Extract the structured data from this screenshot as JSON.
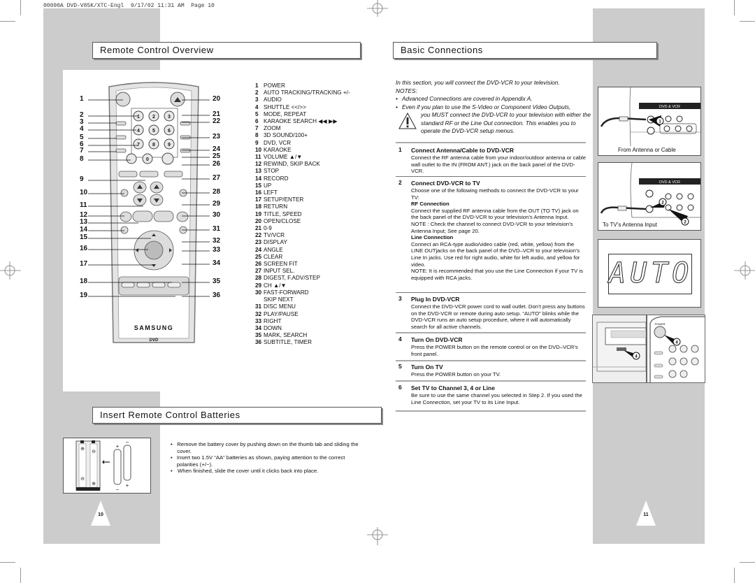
{
  "print_header": "00090A DVD-V85K/XTC-Engl  9/17/02 11:31 AM  Page 10",
  "left_page": {
    "section_title": "Remote Control Overview",
    "remote": {
      "brand": "SAMSUNG",
      "logo": "DVD",
      "callouts_left": [
        "1",
        "2",
        "3",
        "4",
        "5",
        "6",
        "7",
        "8",
        "9",
        "10",
        "11",
        "12",
        "13",
        "14",
        "15",
        "16",
        "17",
        "18",
        "19"
      ],
      "callouts_right": [
        "20",
        "21",
        "22",
        "23",
        "24",
        "25",
        "26",
        "27",
        "28",
        "29",
        "30",
        "31",
        "32",
        "33",
        "34",
        "35",
        "36"
      ]
    },
    "legend": [
      {
        "n": "1",
        "label": "POWER"
      },
      {
        "n": "2",
        "label": "AUTO TRACKING/TRACKING +/-"
      },
      {
        "n": "3",
        "label": "AUDIO"
      },
      {
        "n": "4",
        "label": "SHUTTLE <</>>"
      },
      {
        "n": "5",
        "label": "MODE, REPEAT"
      },
      {
        "n": "6",
        "label": "KARAOKE SEARCH ◀◀ ▶▶"
      },
      {
        "n": "7",
        "label": "ZOOM"
      },
      {
        "n": "8",
        "label": "3D SOUND/100+"
      },
      {
        "n": "9",
        "label": "DVD, VCR"
      },
      {
        "n": "10",
        "label": "KARAOKE"
      },
      {
        "n": "11",
        "label": "VOLUME ▲/▼"
      },
      {
        "n": "12",
        "label": "REWIND, SKIP BACK"
      },
      {
        "n": "13",
        "label": "STOP"
      },
      {
        "n": "14",
        "label": "RECORD"
      },
      {
        "n": "15",
        "label": "UP"
      },
      {
        "n": "16",
        "label": "LEFT"
      },
      {
        "n": "17",
        "label": "SETUP/ENTER"
      },
      {
        "n": "18",
        "label": "RETURN"
      },
      {
        "n": "19",
        "label": "TITLE, SPEED"
      },
      {
        "n": "20",
        "label": "OPEN/CLOSE"
      },
      {
        "n": "21",
        "label": "0-9"
      },
      {
        "n": "22",
        "label": "TV/VCR"
      },
      {
        "n": "23",
        "label": "DISPLAY"
      },
      {
        "n": "24",
        "label": "ANGLE"
      },
      {
        "n": "25",
        "label": "CLEAR"
      },
      {
        "n": "26",
        "label": "SCREEN FIT"
      },
      {
        "n": "27",
        "label": "INPUT SEL."
      },
      {
        "n": "28",
        "label": "DIGEST, F.ADV/STEP"
      },
      {
        "n": "29",
        "label": "CH ▲/▼"
      },
      {
        "n": "30",
        "label": "FAST-FORWARD"
      },
      {
        "n": "",
        "label": "SKIP NEXT"
      },
      {
        "n": "31",
        "label": "DISC MENU"
      },
      {
        "n": "32",
        "label": "PLAY/PAUSE"
      },
      {
        "n": "33",
        "label": "RIGHT"
      },
      {
        "n": "34",
        "label": "DOWN"
      },
      {
        "n": "35",
        "label": "MARK, SEARCH"
      },
      {
        "n": "36",
        "label": "SUBTITLE, TIMER"
      }
    ],
    "batteries": {
      "section_title": "Insert Remote Control Batteries",
      "bullets": [
        "Remove the battery cover by pushing down on the thumb tab and sliding the cover.",
        "Insert two 1.5V “AA” batteries as shown, paying attention to the correct polarities (+/−).",
        "When finished, slide the cover until it clicks back into place."
      ]
    },
    "page_number": "10"
  },
  "right_page": {
    "section_title": "Basic Connections",
    "intro": "In this section, you will connect the DVD-VCR to your television.",
    "notes_label": "NOTES:",
    "notes": [
      "Advanced Connections are covered in Appendix A.",
      "Even if you plan to use the S-Video or Component Video Outputs,"
    ],
    "warning": "you MUST connect the DVD-VCR to your television with either the standard RF or the Line Out connection. This enables you to operate the DVD-VCR setup menus.",
    "steps": [
      {
        "n": "1",
        "title": "Connect Antenna/Cable to DVD-VCR",
        "body": "Connect the RF antenna cable from your indoor/outdoor antenna or cable wall outlet to the IN (FROM ANT.) jack on the back panel of the DVD-VCR."
      },
      {
        "n": "2",
        "title": "Connect DVD-VCR to TV",
        "body": "Choose one of the following methods to connect the DVD-VCR to your TV:",
        "rf_label": "RF Connection",
        "rf_body": "Connect the supplied RF antenna cable from the OUT (TO TV) jack on the back panel of the DVD-VCR to your television’s Antenna Input.",
        "rf_note": "NOTE : Check the channel to connect DVD-VCR to your television’s Antenna Input; See page 20.",
        "line_label": "Line Connection",
        "line_body": "Connect an RCA-type audio/video cable (red, white, yellow) from the LINE OUTjacks on the back panel of the DVD–VCR to your television’s Line In jacks. Use red for right audio, white for left audio, and yellow for video.",
        "line_note": "NOTE: It is recommended that you use the Line Connection if your TV is equipped with RCA jacks."
      },
      {
        "n": "3",
        "title": "Plug In DVD-VCR",
        "body": "Connect the DVD-VCR power cord to wall outlet. Don’t press any buttons on the DVD-VCR or remote during auto setup. “AUTO” blinks while the DVD-VCR runs an auto setup procedure, where it will automatically search for all active channels."
      },
      {
        "n": "4",
        "title": "Turn On DVD-VCR",
        "body": "Press the POWER button on the remote control or on the DVD–VCR’s front panel."
      },
      {
        "n": "5",
        "title": "Turn On TV",
        "body": "Press the POWER button on your TV."
      },
      {
        "n": "6",
        "title": "Set TV to Channel 3, 4 or Line",
        "body": "Be sure to use the same channel you selected in Step 2. If you used the Line Connection, set your TV to its Line Input."
      }
    ],
    "figures": {
      "fig1_caption": "From Antenna or Cable",
      "fig1_panel": "DVD & VCR",
      "fig2_caption": "To TV’s Antenna Input",
      "fig2_panel": "DVD & VCR",
      "display_text": "AUTO",
      "badge1": "1",
      "badge2": "2",
      "badge4": "4",
      "power_label": "POWER"
    },
    "page_number": "11"
  }
}
